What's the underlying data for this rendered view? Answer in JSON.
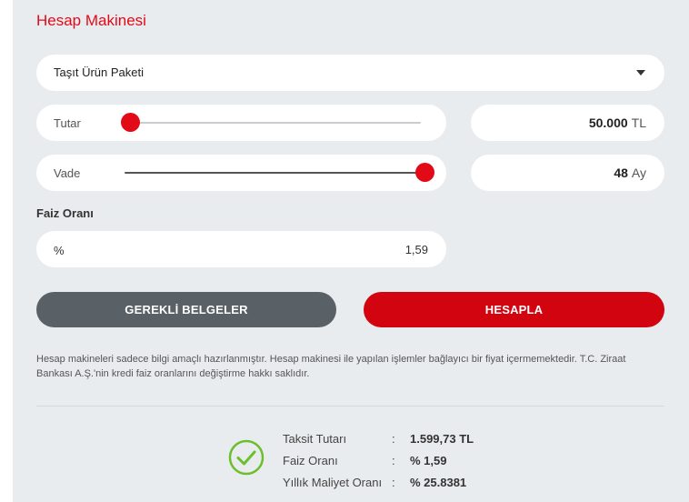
{
  "calculator": {
    "title": "Hesap Makinesi",
    "product_select": {
      "selected": "Taşıt Ürün Paketi"
    },
    "amount": {
      "label": "Tutar",
      "value": "50.000",
      "unit": "TL",
      "slider_fraction": 0.0
    },
    "term": {
      "label": "Vade",
      "value": "48",
      "unit": "Ay",
      "slider_fraction": 1.0
    },
    "interest": {
      "label": "Faiz Oranı",
      "symbol": "%",
      "value": "1,59"
    },
    "buttons": {
      "documents": "GEREKLİ BELGELER",
      "calculate": "HESAPLA"
    },
    "disclaimer": "Hesap makineleri sadece bilgi amaçlı hazırlanmıştır. Hesap makinesi ile yapılan işlemler bağlayıcı bir fiyat içermemektedir. T.C. Ziraat Bankası A.Ş.'nin kredi faiz oranlarını değiştirme hakkı saklıdır.",
    "results": [
      {
        "label": "Taksit Tutarı",
        "sep": ":",
        "value": "1.599,73 TL"
      },
      {
        "label": "Faiz Oranı",
        "sep": ":",
        "value": "% 1,59"
      },
      {
        "label": "Yıllık Maliyet Oranı",
        "sep": ":",
        "value": "% 25.8381"
      }
    ]
  },
  "colors": {
    "accent": "#e30a17",
    "button_dark": "#5a6166",
    "button_red": "#d1040f",
    "success": "#6bbf2a",
    "panel_bg": "#e9ecef"
  }
}
